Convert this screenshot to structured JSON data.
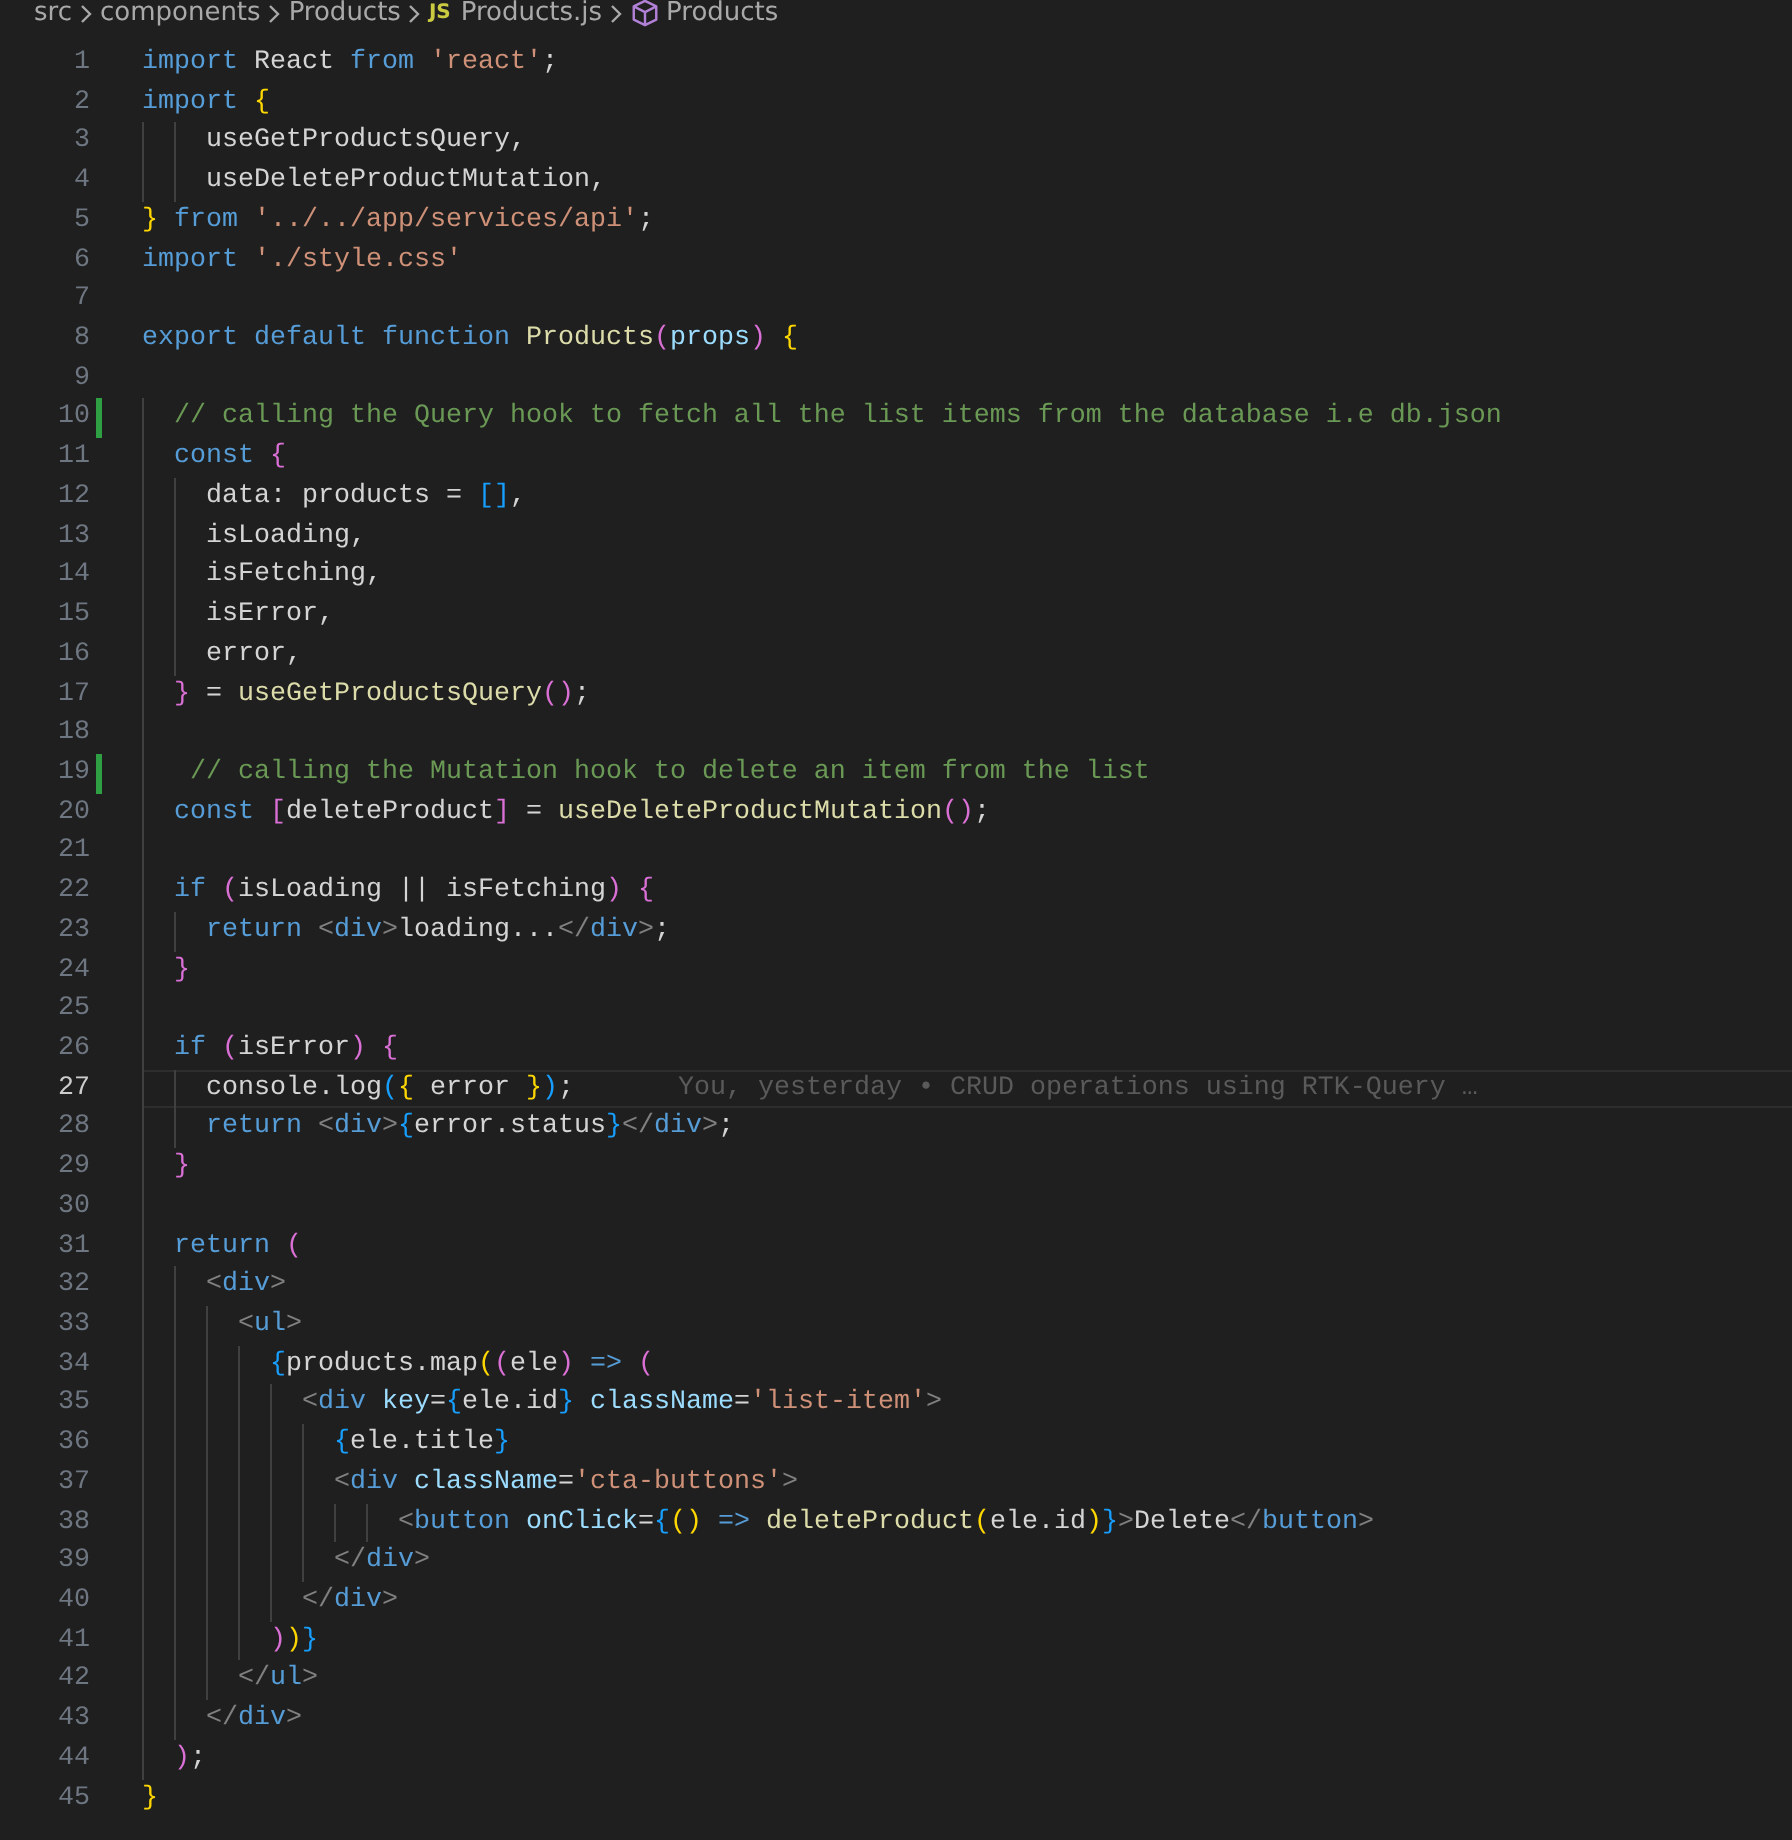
{
  "breadcrumb": [
    {
      "label": "src",
      "kind": "folder"
    },
    {
      "label": "components",
      "kind": "folder"
    },
    {
      "label": "Products",
      "kind": "folder"
    },
    {
      "label": "Products.js",
      "kind": "file",
      "file_badge": "JS"
    },
    {
      "label": "Products",
      "kind": "symbol"
    }
  ],
  "lines": [
    {
      "number": "1",
      "tokens": [
        {
          "kind": "keyword",
          "text": "import"
        },
        {
          "kind": "plain",
          "text": " React "
        },
        {
          "kind": "keyword",
          "text": "from "
        },
        {
          "kind": "string",
          "text": "'react'"
        },
        {
          "kind": "plain",
          "text": ";"
        }
      ]
    },
    {
      "number": "2",
      "tokens": [
        {
          "kind": "keyword",
          "text": "import "
        },
        {
          "kind": "bracket1",
          "text": "{"
        }
      ]
    },
    {
      "number": "3",
      "tokens": [
        {
          "kind": "plain",
          "text": "    useGetProductsQuery,"
        }
      ]
    },
    {
      "number": "4",
      "tokens": [
        {
          "kind": "plain",
          "text": "    useDeleteProductMutation,"
        }
      ]
    },
    {
      "number": "5",
      "tokens": [
        {
          "kind": "bracket1",
          "text": "} "
        },
        {
          "kind": "keyword",
          "text": "from "
        },
        {
          "kind": "string",
          "text": "'../../app/services/api'"
        },
        {
          "kind": "plain",
          "text": ";"
        }
      ]
    },
    {
      "number": "6",
      "tokens": [
        {
          "kind": "keyword",
          "text": "import "
        },
        {
          "kind": "string",
          "text": "'./style.css'"
        }
      ]
    },
    {
      "number": "7"
    },
    {
      "number": "8",
      "tokens": [
        {
          "kind": "keyword",
          "text": "export default function "
        },
        {
          "kind": "function",
          "text": "Products"
        },
        {
          "kind": "bracket2",
          "text": "("
        },
        {
          "kind": "param",
          "text": "props"
        },
        {
          "kind": "bracket2",
          "text": ") "
        },
        {
          "kind": "bracket1",
          "text": "{"
        }
      ]
    },
    {
      "number": "9"
    },
    {
      "number": "10",
      "modified": true,
      "tokens": [
        {
          "kind": "comment",
          "text": "  // calling the Query hook to fetch all the list items from the database i.e db.json"
        }
      ]
    },
    {
      "number": "11",
      "tokens": [
        {
          "kind": "keyword",
          "text": "  const "
        },
        {
          "kind": "bracket2",
          "text": "{"
        }
      ]
    },
    {
      "number": "12",
      "tokens": [
        {
          "kind": "plain",
          "text": "    data: products = "
        },
        {
          "kind": "bracket3",
          "text": "[]"
        },
        {
          "kind": "plain",
          "text": ","
        }
      ]
    },
    {
      "number": "13",
      "tokens": [
        {
          "kind": "plain",
          "text": "    isLoading,"
        }
      ]
    },
    {
      "number": "14",
      "tokens": [
        {
          "kind": "plain",
          "text": "    isFetching,"
        }
      ]
    },
    {
      "number": "15",
      "tokens": [
        {
          "kind": "plain",
          "text": "    isError,"
        }
      ]
    },
    {
      "number": "16",
      "tokens": [
        {
          "kind": "plain",
          "text": "    error,"
        }
      ]
    },
    {
      "number": "17",
      "tokens": [
        {
          "kind": "bracket2",
          "text": "  }"
        },
        {
          "kind": "plain",
          "text": " = "
        },
        {
          "kind": "function",
          "text": "useGetProductsQuery"
        },
        {
          "kind": "bracket2",
          "text": "()"
        },
        {
          "kind": "plain",
          "text": ";"
        }
      ]
    },
    {
      "number": "18"
    },
    {
      "number": "19",
      "modified": true,
      "tokens": [
        {
          "kind": "comment",
          "text": "   // calling the Mutation hook to delete an item from the list"
        }
      ]
    },
    {
      "number": "20",
      "tokens": [
        {
          "kind": "keyword",
          "text": "  const "
        },
        {
          "kind": "bracket2",
          "text": "["
        },
        {
          "kind": "plain",
          "text": "deleteProduct"
        },
        {
          "kind": "bracket2",
          "text": "]"
        },
        {
          "kind": "plain",
          "text": " = "
        },
        {
          "kind": "function",
          "text": "useDeleteProductMutation"
        },
        {
          "kind": "bracket2",
          "text": "()"
        },
        {
          "kind": "plain",
          "text": ";"
        }
      ]
    },
    {
      "number": "21"
    },
    {
      "number": "22",
      "tokens": [
        {
          "kind": "keyword",
          "text": "  if "
        },
        {
          "kind": "bracket2",
          "text": "("
        },
        {
          "kind": "plain",
          "text": "isLoading || isFetching"
        },
        {
          "kind": "bracket2",
          "text": ") {"
        }
      ]
    },
    {
      "number": "23",
      "tokens": [
        {
          "kind": "keyword",
          "text": "    return "
        },
        {
          "kind": "angle",
          "text": "<"
        },
        {
          "kind": "tag",
          "text": "div"
        },
        {
          "kind": "angle",
          "text": ">"
        },
        {
          "kind": "plain",
          "text": "loading..."
        },
        {
          "kind": "angle",
          "text": "</"
        },
        {
          "kind": "tag",
          "text": "div"
        },
        {
          "kind": "angle",
          "text": ">"
        },
        {
          "kind": "plain",
          "text": ";"
        }
      ]
    },
    {
      "number": "24",
      "tokens": [
        {
          "kind": "bracket2",
          "text": "  }"
        }
      ]
    },
    {
      "number": "25"
    },
    {
      "number": "26",
      "tokens": [
        {
          "kind": "keyword",
          "text": "  if "
        },
        {
          "kind": "bracket2",
          "text": "("
        },
        {
          "kind": "plain",
          "text": "isError"
        },
        {
          "kind": "bracket2",
          "text": ") {"
        }
      ]
    },
    {
      "number": "27",
      "current": true,
      "annotation": "You, yesterday • CRUD operations using RTK-Query …",
      "tokens": [
        {
          "kind": "plain",
          "text": "    console.log"
        },
        {
          "kind": "bracket3",
          "text": "("
        },
        {
          "kind": "bracket1",
          "text": "{"
        },
        {
          "kind": "plain",
          "text": " error "
        },
        {
          "kind": "bracket1",
          "text": "}"
        },
        {
          "kind": "bracket3",
          "text": ")"
        },
        {
          "kind": "plain",
          "text": ";"
        }
      ]
    },
    {
      "number": "28",
      "tokens": [
        {
          "kind": "keyword",
          "text": "    return "
        },
        {
          "kind": "angle",
          "text": "<"
        },
        {
          "kind": "tag",
          "text": "div"
        },
        {
          "kind": "angle",
          "text": ">"
        },
        {
          "kind": "bracket3",
          "text": "{"
        },
        {
          "kind": "plain",
          "text": "error.status"
        },
        {
          "kind": "bracket3",
          "text": "}"
        },
        {
          "kind": "angle",
          "text": "</"
        },
        {
          "kind": "tag",
          "text": "div"
        },
        {
          "kind": "angle",
          "text": ">"
        },
        {
          "kind": "plain",
          "text": ";"
        }
      ]
    },
    {
      "number": "29",
      "tokens": [
        {
          "kind": "bracket2",
          "text": "  }"
        }
      ]
    },
    {
      "number": "30"
    },
    {
      "number": "31",
      "tokens": [
        {
          "kind": "keyword",
          "text": "  return "
        },
        {
          "kind": "bracket2",
          "text": "("
        }
      ]
    },
    {
      "number": "32",
      "tokens": [
        {
          "kind": "angle",
          "text": "    <"
        },
        {
          "kind": "tag",
          "text": "div"
        },
        {
          "kind": "angle",
          "text": ">"
        }
      ]
    },
    {
      "number": "33",
      "tokens": [
        {
          "kind": "angle",
          "text": "      <"
        },
        {
          "kind": "tag",
          "text": "ul"
        },
        {
          "kind": "angle",
          "text": ">"
        }
      ]
    },
    {
      "number": "34",
      "tokens": [
        {
          "kind": "bracket3",
          "text": "        {"
        },
        {
          "kind": "plain",
          "text": "products.map"
        },
        {
          "kind": "bracket1",
          "text": "("
        },
        {
          "kind": "bracket2",
          "text": "("
        },
        {
          "kind": "plain",
          "text": "ele"
        },
        {
          "kind": "bracket2",
          "text": ") "
        },
        {
          "kind": "keyword",
          "text": "=> "
        },
        {
          "kind": "bracket2",
          "text": "("
        }
      ]
    },
    {
      "number": "35",
      "tokens": [
        {
          "kind": "angle",
          "text": "          <"
        },
        {
          "kind": "tag",
          "text": "div "
        },
        {
          "kind": "attribute",
          "text": "key"
        },
        {
          "kind": "plain",
          "text": "="
        },
        {
          "kind": "bracket3",
          "text": "{"
        },
        {
          "kind": "plain",
          "text": "ele.id"
        },
        {
          "kind": "bracket3",
          "text": "} "
        },
        {
          "kind": "attribute",
          "text": "className"
        },
        {
          "kind": "plain",
          "text": "="
        },
        {
          "kind": "string",
          "text": "'list-item'"
        },
        {
          "kind": "angle",
          "text": ">"
        }
      ]
    },
    {
      "number": "36",
      "tokens": [
        {
          "kind": "bracket3",
          "text": "            {"
        },
        {
          "kind": "plain",
          "text": "ele.title"
        },
        {
          "kind": "bracket3",
          "text": "}"
        }
      ]
    },
    {
      "number": "37",
      "tokens": [
        {
          "kind": "angle",
          "text": "            <"
        },
        {
          "kind": "tag",
          "text": "div "
        },
        {
          "kind": "attribute",
          "text": "className"
        },
        {
          "kind": "plain",
          "text": "="
        },
        {
          "kind": "string",
          "text": "'cta-buttons'"
        },
        {
          "kind": "angle",
          "text": ">"
        }
      ]
    },
    {
      "number": "38",
      "tokens": [
        {
          "kind": "angle",
          "text": "                <"
        },
        {
          "kind": "tag",
          "text": "button "
        },
        {
          "kind": "attribute",
          "text": "onClick"
        },
        {
          "kind": "plain",
          "text": "="
        },
        {
          "kind": "bracket3",
          "text": "{"
        },
        {
          "kind": "bracket1",
          "text": "() "
        },
        {
          "kind": "keyword",
          "text": "=> "
        },
        {
          "kind": "function",
          "text": "deleteProduct"
        },
        {
          "kind": "bracket1",
          "text": "("
        },
        {
          "kind": "plain",
          "text": "ele.id"
        },
        {
          "kind": "bracket1",
          "text": ")"
        },
        {
          "kind": "bracket3",
          "text": "}"
        },
        {
          "kind": "angle",
          "text": ">"
        },
        {
          "kind": "plain",
          "text": "Delete"
        },
        {
          "kind": "angle",
          "text": "</"
        },
        {
          "kind": "tag",
          "text": "button"
        },
        {
          "kind": "angle",
          "text": ">"
        }
      ]
    },
    {
      "number": "39",
      "tokens": [
        {
          "kind": "angle",
          "text": "            </"
        },
        {
          "kind": "tag",
          "text": "div"
        },
        {
          "kind": "angle",
          "text": ">"
        }
      ]
    },
    {
      "number": "40",
      "tokens": [
        {
          "kind": "angle",
          "text": "          </"
        },
        {
          "kind": "tag",
          "text": "div"
        },
        {
          "kind": "angle",
          "text": ">"
        }
      ]
    },
    {
      "number": "41",
      "tokens": [
        {
          "kind": "bracket2",
          "text": "        )"
        },
        {
          "kind": "bracket1",
          "text": ")"
        },
        {
          "kind": "bracket3",
          "text": "}"
        }
      ]
    },
    {
      "number": "42",
      "tokens": [
        {
          "kind": "angle",
          "text": "      </"
        },
        {
          "kind": "tag",
          "text": "ul"
        },
        {
          "kind": "angle",
          "text": ">"
        }
      ]
    },
    {
      "number": "43",
      "tokens": [
        {
          "kind": "angle",
          "text": "    </"
        },
        {
          "kind": "tag",
          "text": "div"
        },
        {
          "kind": "angle",
          "text": ">"
        }
      ]
    },
    {
      "number": "44",
      "tokens": [
        {
          "kind": "bracket2",
          "text": "  )"
        },
        {
          "kind": "plain",
          "text": ";"
        }
      ]
    },
    {
      "number": "45",
      "tokens": [
        {
          "kind": "bracket1",
          "text": "}"
        }
      ]
    }
  ]
}
